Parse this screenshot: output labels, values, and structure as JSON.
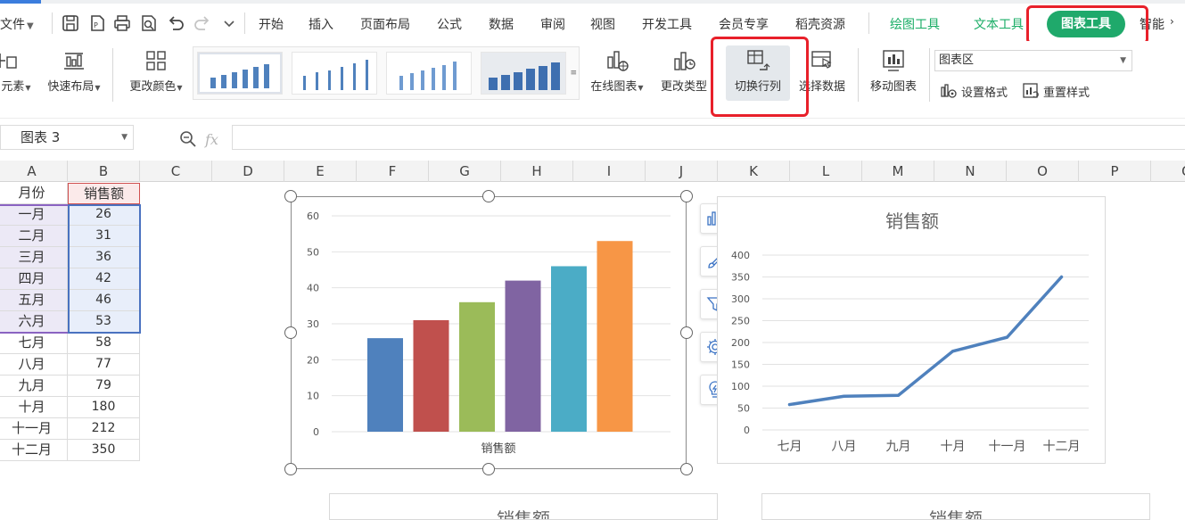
{
  "app": {
    "file_menu": "文件",
    "menus": [
      "开始",
      "插入",
      "页面布局",
      "公式",
      "数据",
      "审阅",
      "视图",
      "开发工具",
      "会员专享",
      "稻壳资源"
    ],
    "context_tabs": [
      "绘图工具",
      "文本工具"
    ],
    "active_tab": "图表工具",
    "overflow_tab": "智能"
  },
  "ribbon": {
    "add_element": "元素",
    "quick_layout": "快速布局",
    "change_color": "更改颜色",
    "online_chart": "在线图表",
    "change_type": "更改类型",
    "switch_row_col": "切换行列",
    "select_data": "选择数据",
    "move_chart": "移动图表",
    "chart_area_select": "图表区",
    "set_format": "设置格式",
    "reset_style": "重置样式"
  },
  "formula_bar": {
    "name_box": "图表 3",
    "fx_label": "fx",
    "formula": ""
  },
  "sheet": {
    "columns": [
      "A",
      "B",
      "C",
      "D",
      "E",
      "F",
      "G",
      "H",
      "I",
      "J",
      "K",
      "L",
      "M",
      "N",
      "O",
      "P",
      "Q"
    ],
    "header_row": [
      "月份",
      "销售额"
    ],
    "rows": [
      [
        "一月",
        "26"
      ],
      [
        "二月",
        "31"
      ],
      [
        "三月",
        "36"
      ],
      [
        "四月",
        "42"
      ],
      [
        "五月",
        "46"
      ],
      [
        "六月",
        "53"
      ],
      [
        "七月",
        "58"
      ],
      [
        "八月",
        "77"
      ],
      [
        "九月",
        "79"
      ],
      [
        "十月",
        "180"
      ],
      [
        "十一月",
        "212"
      ],
      [
        "十二月",
        "350"
      ]
    ]
  },
  "chart_data": [
    {
      "type": "bar",
      "categories": [
        "一月",
        "二月",
        "三月",
        "四月",
        "五月",
        "六月"
      ],
      "values": [
        26,
        31,
        36,
        42,
        46,
        53
      ],
      "xlabel": "销售额",
      "ylim": [
        0,
        60
      ],
      "yticks": [
        0,
        10,
        20,
        30,
        40,
        50,
        60
      ],
      "grid": true,
      "colors": [
        "#4f81bd",
        "#c0504d",
        "#9bbb59",
        "#8064a2",
        "#4bacc6",
        "#f79646"
      ]
    },
    {
      "type": "line",
      "title": "销售额",
      "categories": [
        "七月",
        "八月",
        "九月",
        "十月",
        "十一月",
        "十二月"
      ],
      "values": [
        58,
        77,
        79,
        180,
        212,
        350
      ],
      "ylim": [
        0,
        400
      ],
      "yticks": [
        0,
        50,
        100,
        150,
        200,
        250,
        300,
        350,
        400
      ],
      "grid": true,
      "color": "#4f81bd"
    }
  ],
  "partial_charts": [
    "销售额",
    "销售额"
  ],
  "colors": {
    "accent_green": "#1fa96b",
    "highlight_red": "#e8202a"
  }
}
